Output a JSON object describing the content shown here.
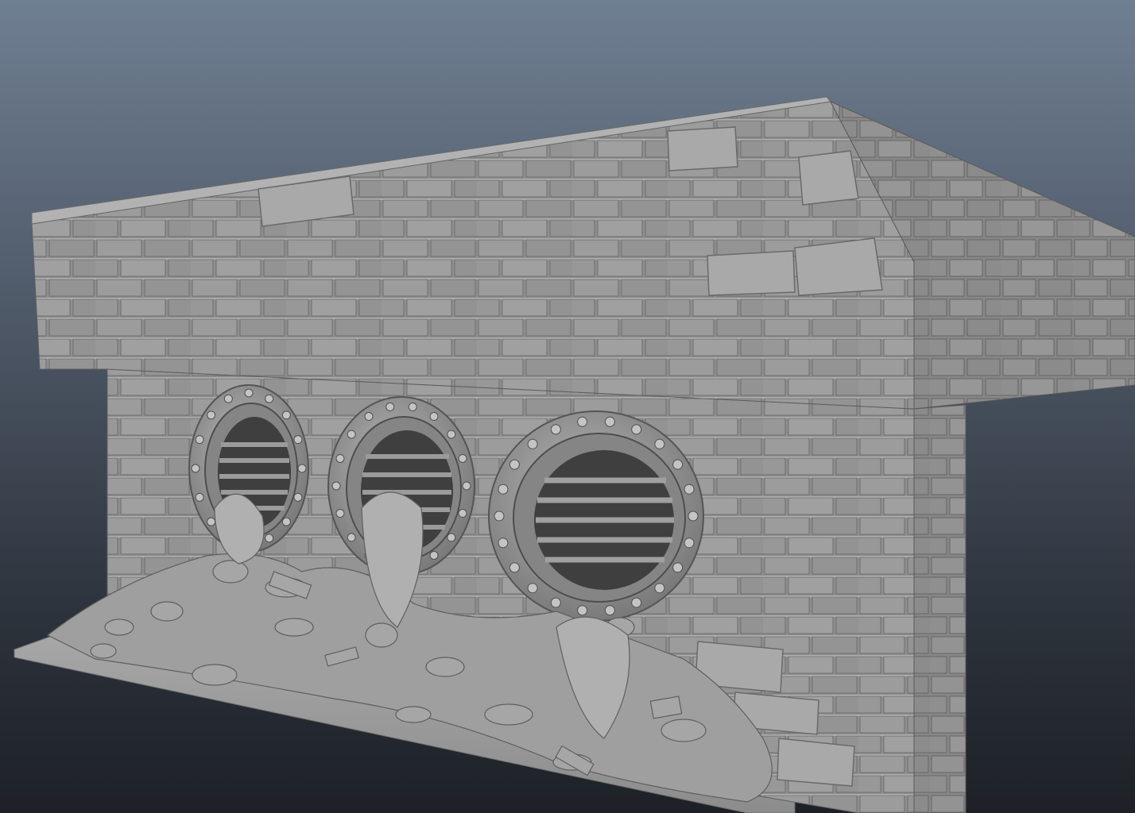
{
  "viewport": {
    "background_top": "#6f7f92",
    "background_bottom": "#1d2127"
  },
  "model": {
    "material_color": "#9a9a9a",
    "brick_light": "#a4a4a4",
    "brick_dark": "#7e7e7e",
    "mortar": "#d2d2d2",
    "pipe_count": 3
  }
}
